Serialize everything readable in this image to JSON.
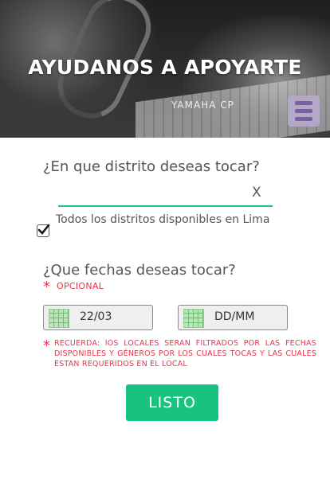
{
  "header": {
    "title": "AYUDANOS A APOYARTE",
    "brand_text": "YAMAHA CP",
    "menu_icon": "hamburger-menu-icon"
  },
  "district": {
    "question": "¿En que distrito deseas tocar?",
    "input_value": "",
    "clear_label": "X",
    "all_checkbox_checked": true,
    "all_checkbox_label": "Todos los distritos disponibles en Lima"
  },
  "dates": {
    "question": "¿Que fechas deseas tocar?",
    "required_mark": "*",
    "optional_label": "OPCIONAL",
    "start_value": "22/03",
    "end_placeholder": "DD/MM",
    "calendar_icon": "calendar-icon",
    "note_mark": "*",
    "note": "RECUERDA: lOS LOCALES SERAN FILTRADOS POR LAS FECHAS DISPONIBLES Y GÉNEROS POR LOS CUALES TOCAS Y LAS CUALES ESTAN REQUERIDOS EN EL LOCAL"
  },
  "actions": {
    "submit_label": "LISTO"
  },
  "colors": {
    "accent": "#1ac27f",
    "warning": "#e8344a",
    "menu_bg": "#b5a9c9",
    "menu_lines": "#7b5ba5"
  }
}
